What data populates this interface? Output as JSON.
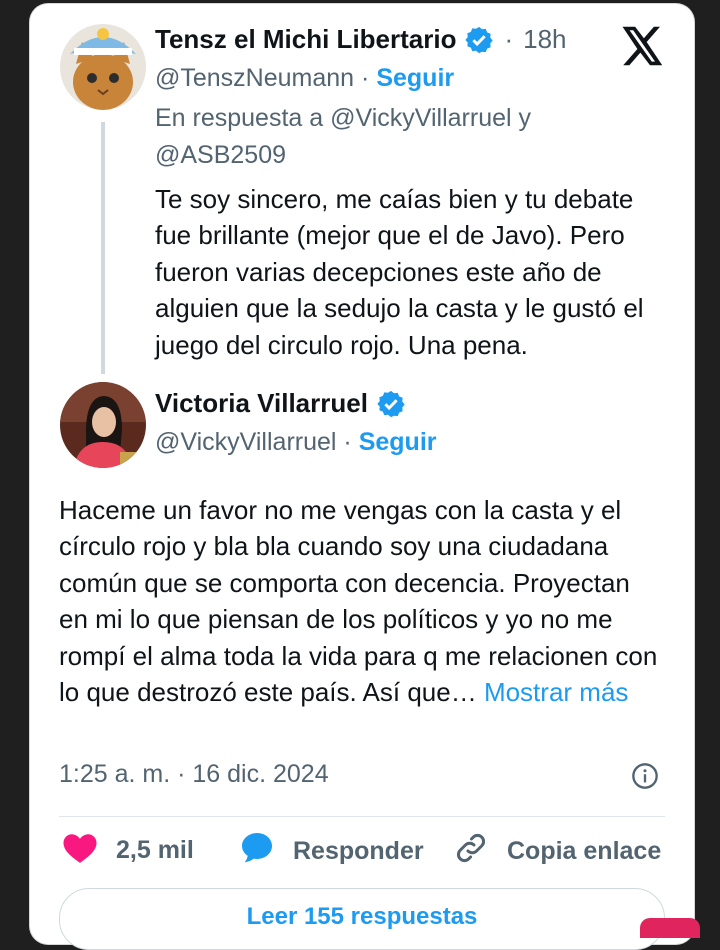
{
  "reply_tweet": {
    "author_name": "Tensz el Michi Libertario",
    "time_sep": "·",
    "time_ago": "18h",
    "handle": "@TenszNeumann",
    "dot": "·",
    "follow_label": "Seguir",
    "reply_context": "En respuesta a @VickyVillarruel y @ASB2509",
    "text": "Te soy sincero, me caías bien y tu debate fue brillante (mejor que el de Javo). Pero fueron varias decepciones este año de alguien que la sedujo la casta y le gustó el juego del circulo rojo. Una pena."
  },
  "main_tweet": {
    "author_name": "Victoria Villarruel",
    "handle": "@VickyVillarruel",
    "dot": "·",
    "follow_label": "Seguir",
    "text": "Haceme un favor no me vengas con la casta y el círculo rojo y bla bla cuando soy una ciudadana común que se comporta con decencia. Proyectan en mi lo que piensan de los políticos y yo no me rompí el alma toda la vida para q me relacionen con lo que destrozó este país. Así que…",
    "show_more": "Mostrar más",
    "timestamp": "1:25 a. m. · 16 dic. 2024"
  },
  "actions": {
    "likes_count": "2,5 mil",
    "reply_label": "Responder",
    "copy_link_label": "Copia enlace"
  },
  "read_replies_label": "Leer 155 respuestas",
  "icons": {
    "brand": "x-logo-icon",
    "verified": "verified-badge-icon",
    "info": "info-icon",
    "like": "heart-icon",
    "reply": "speech-bubble-icon",
    "copy_link": "link-icon"
  },
  "colors": {
    "accent": "#1d9bf0",
    "like": "#f91880",
    "text": "#0f1419",
    "muted": "#536471"
  }
}
